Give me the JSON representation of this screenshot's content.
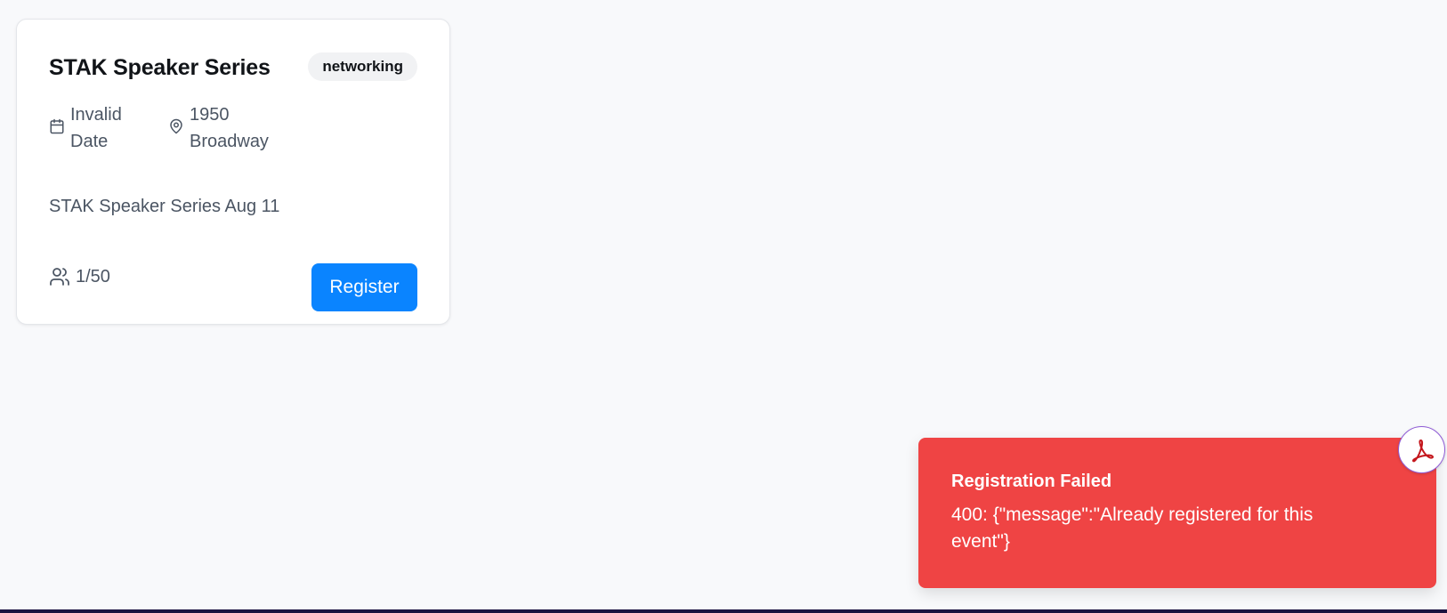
{
  "event_card": {
    "title": "STAK Speaker Series",
    "tag": "networking",
    "date_line1": "Invalid",
    "date_line2": "Date",
    "location_line1": "1950",
    "location_line2": "Broadway",
    "description": "STAK Speaker Series Aug 11",
    "attendees": "1/50",
    "register_label": "Register",
    "accent_color": "#0a84ff",
    "icons": [
      "calendar-icon",
      "map-pin-icon",
      "users-icon"
    ]
  },
  "toast": {
    "title": "Registration Failed",
    "message": "400: {\"message\":\"Already registered for this event\"}",
    "color": "#ef4444"
  },
  "floating_badge": {
    "icon": "pdf-reader-icon"
  }
}
